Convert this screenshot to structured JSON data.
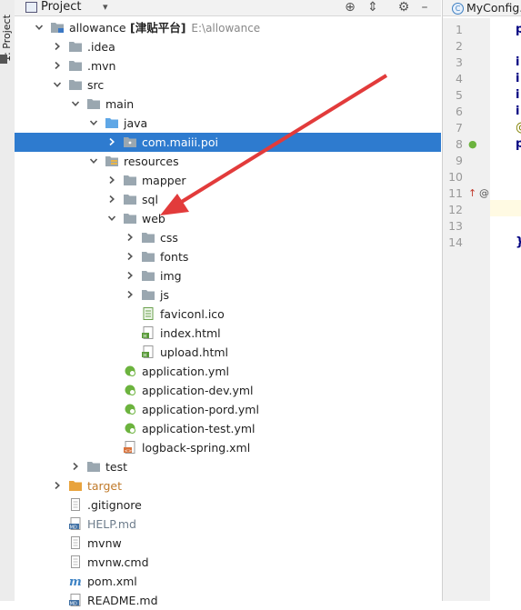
{
  "left_strip": {
    "label": "1: Project"
  },
  "header": {
    "title": "Project",
    "dropdown_glyph": "▾",
    "icons": [
      "crosshair-icon",
      "collapse-all-icon",
      "gear-icon",
      "hide-icon"
    ]
  },
  "tree": [
    {
      "label": "allowance",
      "suffix": "[津贴平台]",
      "hint": "E:\\allowance",
      "icon": "module-folder",
      "expanded": true,
      "depth": 0,
      "arrow": "down",
      "style": "normal"
    },
    {
      "label": ".idea",
      "icon": "folder",
      "depth": 1,
      "arrow": "right",
      "style": "normal"
    },
    {
      "label": ".mvn",
      "icon": "folder",
      "depth": 1,
      "arrow": "right",
      "style": "normal"
    },
    {
      "label": "src",
      "icon": "folder",
      "depth": 1,
      "arrow": "down",
      "style": "normal"
    },
    {
      "label": "main",
      "icon": "folder",
      "depth": 2,
      "arrow": "down",
      "style": "normal"
    },
    {
      "label": "java",
      "icon": "source-folder",
      "depth": 3,
      "arrow": "down",
      "style": "normal"
    },
    {
      "label": "com.maiii.poi",
      "icon": "package",
      "depth": 4,
      "arrow": "right",
      "style": "selected"
    },
    {
      "label": "resources",
      "icon": "resources-folder",
      "depth": 3,
      "arrow": "down",
      "style": "normal"
    },
    {
      "label": "mapper",
      "icon": "folder",
      "depth": 4,
      "arrow": "right",
      "style": "normal"
    },
    {
      "label": "sql",
      "icon": "folder",
      "depth": 4,
      "arrow": "right",
      "style": "normal"
    },
    {
      "label": "web",
      "icon": "folder",
      "depth": 4,
      "arrow": "down",
      "style": "normal"
    },
    {
      "label": "css",
      "icon": "folder",
      "depth": 5,
      "arrow": "right",
      "style": "normal"
    },
    {
      "label": "fonts",
      "icon": "folder",
      "depth": 5,
      "arrow": "right",
      "style": "normal"
    },
    {
      "label": "img",
      "icon": "folder",
      "depth": 5,
      "arrow": "right",
      "style": "normal"
    },
    {
      "label": "js",
      "icon": "folder",
      "depth": 5,
      "arrow": "right",
      "style": "normal"
    },
    {
      "label": "faviconl.ico",
      "icon": "ico-file",
      "depth": 5,
      "arrow": "none",
      "style": "normal"
    },
    {
      "label": "index.html",
      "icon": "html-file",
      "depth": 5,
      "arrow": "none",
      "style": "normal"
    },
    {
      "label": "upload.html",
      "icon": "html-file",
      "depth": 5,
      "arrow": "none",
      "style": "normal"
    },
    {
      "label": "application.yml",
      "icon": "spring-yml",
      "depth": 4,
      "arrow": "none",
      "style": "normal"
    },
    {
      "label": "application-dev.yml",
      "icon": "spring-yml",
      "depth": 4,
      "arrow": "none",
      "style": "normal"
    },
    {
      "label": "application-pord.yml",
      "icon": "spring-yml",
      "depth": 4,
      "arrow": "none",
      "style": "normal"
    },
    {
      "label": "application-test.yml",
      "icon": "spring-yml",
      "depth": 4,
      "arrow": "none",
      "style": "normal"
    },
    {
      "label": "logback-spring.xml",
      "icon": "xml-file",
      "depth": 4,
      "arrow": "none",
      "style": "normal"
    },
    {
      "label": "test",
      "icon": "folder",
      "depth": 2,
      "arrow": "right",
      "style": "normal"
    },
    {
      "label": "target",
      "icon": "excluded-folder",
      "depth": 1,
      "arrow": "right",
      "style": "orange"
    },
    {
      "label": ".gitignore",
      "icon": "text-file",
      "depth": 1,
      "arrow": "none",
      "style": "normal"
    },
    {
      "label": "HELP.md",
      "icon": "md-file",
      "depth": 1,
      "arrow": "none",
      "style": "muted"
    },
    {
      "label": "mvnw",
      "icon": "text-file",
      "depth": 1,
      "arrow": "none",
      "style": "normal"
    },
    {
      "label": "mvnw.cmd",
      "icon": "text-file",
      "depth": 1,
      "arrow": "none",
      "style": "normal"
    },
    {
      "label": "pom.xml",
      "icon": "maven-file",
      "depth": 1,
      "arrow": "none",
      "style": "normal"
    },
    {
      "label": "README.md",
      "icon": "md-file",
      "depth": 1,
      "arrow": "none",
      "style": "normal"
    }
  ],
  "editor": {
    "tab_label": "MyConfig.j",
    "tab_icon": "C",
    "line_numbers": [
      "1",
      "2",
      "3",
      "4",
      "5",
      "6",
      "7",
      "8",
      "9",
      "10",
      "11",
      "12",
      "13",
      "14"
    ],
    "code_fragments": [
      {
        "line": 1,
        "text": "p"
      },
      {
        "line": 3,
        "text": "i"
      },
      {
        "line": 4,
        "text": "i"
      },
      {
        "line": 5,
        "text": "i"
      },
      {
        "line": 6,
        "text": "i"
      },
      {
        "line": 7,
        "text": "@"
      },
      {
        "line": 8,
        "text": "p"
      },
      {
        "line": 14,
        "text": "}"
      }
    ],
    "gutter_icons": [
      {
        "line": 8,
        "name": "spring-bean-icon"
      },
      {
        "line": 11,
        "name": "override-icon"
      },
      {
        "line": 11,
        "name": "annotation-icon"
      }
    ]
  },
  "annotation": {
    "name": "red-pointer-arrow",
    "color": "#e23b3b"
  }
}
